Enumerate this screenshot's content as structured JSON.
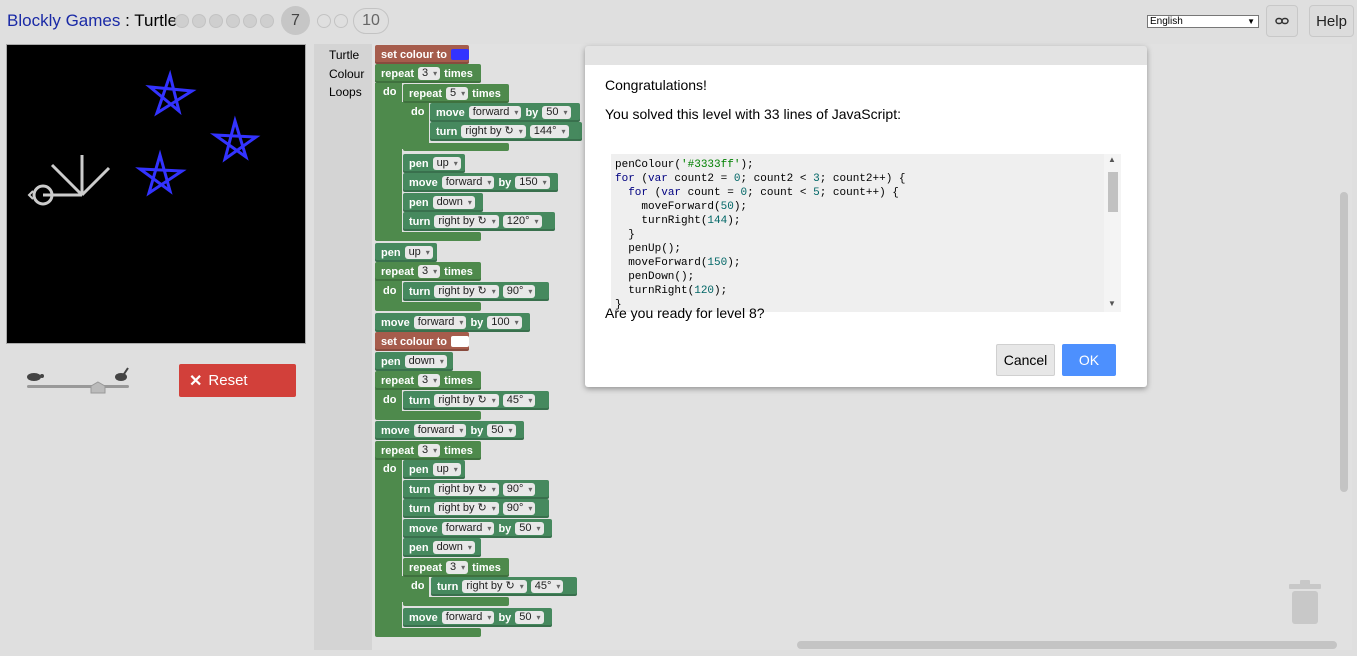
{
  "header": {
    "app_name": "Blockly Games",
    "separator": " : ",
    "game_name": "Turtle",
    "current_level": "7",
    "last_level": "10",
    "language": "English",
    "help_label": "Help"
  },
  "controls": {
    "reset_label": "Reset",
    "speed_level": 0.75
  },
  "toolbox": {
    "categories": [
      "Turtle",
      "Colour",
      "Loops"
    ]
  },
  "blocks": {
    "set_colour": "set colour to",
    "repeat": "repeat",
    "times": "times",
    "do": "do",
    "move": "move",
    "forward": "forward",
    "by": "by",
    "turn": "turn",
    "right_by": "right by ↻",
    "pen": "pen",
    "up": "up",
    "down": "down",
    "n3": "3",
    "n5": "5",
    "v50": "50",
    "v150": "150",
    "v100": "100",
    "a144": "144°",
    "a120": "120°",
    "a90": "90°",
    "a45": "45°",
    "colour_blue": "#3333ff",
    "colour_white": "#ffffff"
  },
  "dialog": {
    "congrats": "Congratulations!",
    "solved": "You solved this level with 33 lines of JavaScript:",
    "code_lines": [
      "penColour('#3333ff');",
      "for (var count2 = 0; count2 < 3; count2++) {",
      "  for (var count = 0; count < 5; count++) {",
      "    moveForward(50);",
      "    turnRight(144);",
      "  }",
      "  penUp();",
      "  moveForward(150);",
      "  penDown();",
      "  turnRight(120);",
      "}"
    ],
    "question": "Are you ready for level 8?",
    "cancel_label": "Cancel",
    "ok_label": "OK"
  },
  "colors": {
    "star": "#3333ff",
    "reset_bg": "#d2403a",
    "ok_bg": "#4d90fe",
    "block_green": "#4e8a4c",
    "block_colour": "#a65c4c"
  }
}
